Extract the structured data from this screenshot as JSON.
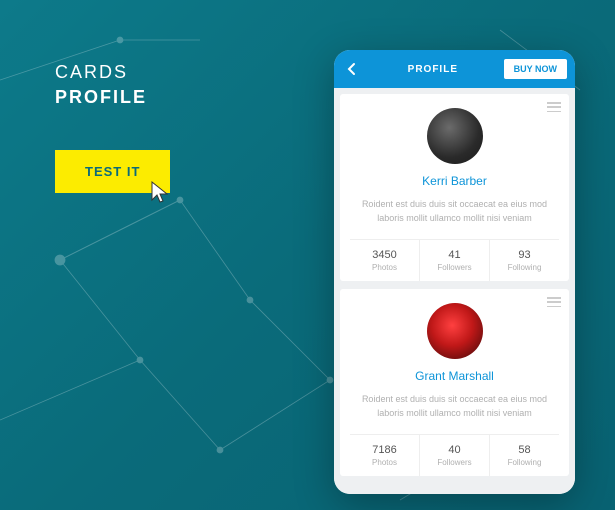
{
  "heading": {
    "line1": "CARDS",
    "line2": "PROFILE"
  },
  "test_button": "TEST IT",
  "appbar": {
    "title": "PROFILE",
    "buy": "BUY NOW"
  },
  "cards": [
    {
      "name": "Kerri Barber",
      "bio": "Roident est duis duis sit occaecat ea eius mod laboris mollit ullamco mollit nisi veniam",
      "stats": [
        {
          "num": "3450",
          "lbl": "Photos"
        },
        {
          "num": "41",
          "lbl": "Followers"
        },
        {
          "num": "93",
          "lbl": "Following"
        }
      ]
    },
    {
      "name": "Grant Marshall",
      "bio": "Roident est duis duis sit occaecat ea eius mod laboris mollit ullamco mollit nisi veniam",
      "stats": [
        {
          "num": "7186",
          "lbl": "Photos"
        },
        {
          "num": "40",
          "lbl": "Followers"
        },
        {
          "num": "58",
          "lbl": "Following"
        }
      ]
    }
  ]
}
